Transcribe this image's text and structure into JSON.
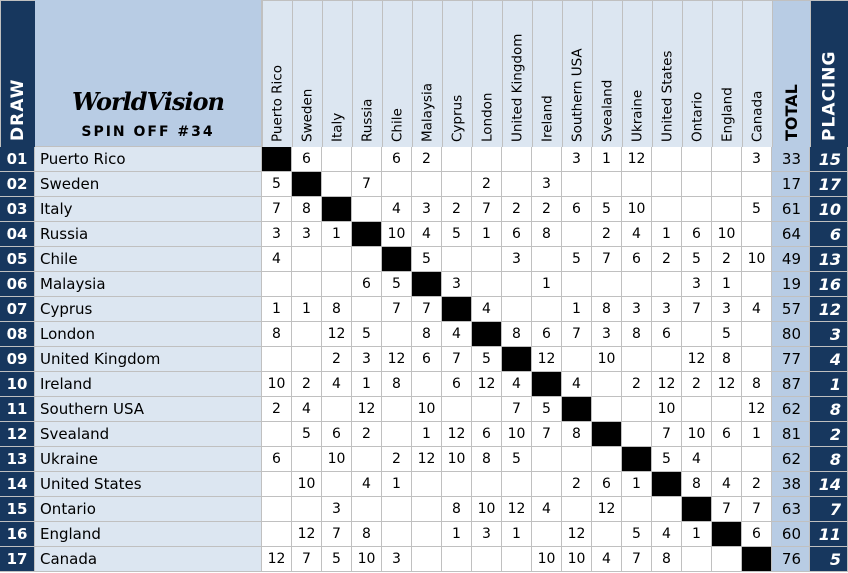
{
  "header": {
    "draw_label": "DRAW",
    "logo": "WorldVision",
    "subtitle": "SPIN OFF #34",
    "total_label": "TOTAL",
    "placing_label": "PLACING"
  },
  "juries": [
    "Puerto Rico",
    "Sweden",
    "Italy",
    "Russia",
    "Chile",
    "Malaysia",
    "Cyprus",
    "London",
    "United Kingdom",
    "Ireland",
    "Southern USA",
    "Svealand",
    "Ukraine",
    "United States",
    "Ontario",
    "England",
    "Canada"
  ],
  "colors": {
    "navy": "#17375e",
    "header_blue": "#b8cce4",
    "row_blue": "#dce6f1",
    "diagonal": "#000000"
  },
  "rows": [
    {
      "draw": "01",
      "name": "Puerto Rico",
      "points": [
        "",
        "6",
        "",
        "",
        "6",
        "2",
        "",
        "",
        "",
        "",
        "3",
        "1",
        "12",
        "",
        "",
        "",
        "3"
      ],
      "total": "33",
      "placing": "15"
    },
    {
      "draw": "02",
      "name": "Sweden",
      "points": [
        "5",
        "",
        "",
        "7",
        "",
        "",
        "",
        "2",
        "",
        "3",
        "",
        "",
        "",
        "",
        "",
        "",
        ""
      ],
      "total": "17",
      "placing": "17"
    },
    {
      "draw": "03",
      "name": "Italy",
      "points": [
        "7",
        "8",
        "",
        "",
        "4",
        "3",
        "2",
        "7",
        "2",
        "2",
        "6",
        "5",
        "10",
        "",
        "",
        "",
        "5"
      ],
      "total": "61",
      "placing": "10"
    },
    {
      "draw": "04",
      "name": "Russia",
      "points": [
        "3",
        "3",
        "1",
        "",
        "10",
        "4",
        "5",
        "1",
        "6",
        "8",
        "",
        "2",
        "4",
        "1",
        "6",
        "10",
        ""
      ],
      "total": "64",
      "placing": "6"
    },
    {
      "draw": "05",
      "name": "Chile",
      "points": [
        "4",
        "",
        "",
        "",
        "",
        "5",
        "",
        "",
        "3",
        "",
        "5",
        "7",
        "6",
        "2",
        "5",
        "2",
        "10"
      ],
      "total": "49",
      "placing": "13"
    },
    {
      "draw": "06",
      "name": "Malaysia",
      "points": [
        "",
        "",
        "",
        "6",
        "5",
        "",
        "3",
        "",
        "",
        "1",
        "",
        "",
        "",
        "",
        "3",
        "1",
        ""
      ],
      "total": "19",
      "placing": "16"
    },
    {
      "draw": "07",
      "name": "Cyprus",
      "points": [
        "1",
        "1",
        "8",
        "",
        "7",
        "7",
        "",
        "4",
        "",
        "",
        "1",
        "8",
        "3",
        "3",
        "7",
        "3",
        "4"
      ],
      "total": "57",
      "placing": "12"
    },
    {
      "draw": "08",
      "name": "London",
      "points": [
        "8",
        "",
        "12",
        "5",
        "",
        "8",
        "4",
        "",
        "8",
        "6",
        "7",
        "3",
        "8",
        "6",
        "",
        "5",
        ""
      ],
      "total": "80",
      "placing": "3"
    },
    {
      "draw": "09",
      "name": "United Kingdom",
      "points": [
        "",
        "",
        "2",
        "3",
        "12",
        "6",
        "7",
        "5",
        "",
        "12",
        "",
        "10",
        "",
        "",
        "12",
        "8",
        ""
      ],
      "total": "77",
      "placing": "4"
    },
    {
      "draw": "10",
      "name": "Ireland",
      "points": [
        "10",
        "2",
        "4",
        "1",
        "8",
        "",
        "6",
        "12",
        "4",
        "",
        "4",
        "",
        "2",
        "12",
        "2",
        "12",
        "8"
      ],
      "total": "87",
      "placing": "1"
    },
    {
      "draw": "11",
      "name": "Southern USA",
      "points": [
        "2",
        "4",
        "",
        "12",
        "",
        "10",
        "",
        "",
        "7",
        "5",
        "",
        "",
        "",
        "10",
        "",
        "",
        "12"
      ],
      "total": "62",
      "placing": "8"
    },
    {
      "draw": "12",
      "name": "Svealand",
      "points": [
        "",
        "5",
        "6",
        "2",
        "",
        "1",
        "12",
        "6",
        "10",
        "7",
        "8",
        "",
        "",
        "7",
        "10",
        "6",
        "1"
      ],
      "total": "81",
      "placing": "2"
    },
    {
      "draw": "13",
      "name": "Ukraine",
      "points": [
        "6",
        "",
        "10",
        "",
        "2",
        "12",
        "10",
        "8",
        "5",
        "",
        "",
        "",
        "",
        "5",
        "4",
        "",
        ""
      ],
      "total": "62",
      "placing": "8"
    },
    {
      "draw": "14",
      "name": "United States",
      "points": [
        "",
        "10",
        "",
        "4",
        "1",
        "",
        "",
        "",
        "",
        "",
        "2",
        "6",
        "1",
        "",
        "8",
        "4",
        "2"
      ],
      "total": "38",
      "placing": "14"
    },
    {
      "draw": "15",
      "name": "Ontario",
      "points": [
        "",
        "",
        "3",
        "",
        "",
        "",
        "8",
        "10",
        "12",
        "4",
        "",
        "12",
        "",
        "",
        "",
        "7",
        "7"
      ],
      "total": "63",
      "placing": "7"
    },
    {
      "draw": "16",
      "name": "England",
      "points": [
        "",
        "12",
        "7",
        "8",
        "",
        "",
        "1",
        "3",
        "1",
        "",
        "12",
        "",
        "5",
        "4",
        "1",
        "",
        "6"
      ],
      "total": "60",
      "placing": "11"
    },
    {
      "draw": "17",
      "name": "Canada",
      "points": [
        "12",
        "7",
        "5",
        "10",
        "3",
        "",
        "",
        "",
        "",
        "10",
        "10",
        "4",
        "7",
        "8",
        "",
        "",
        ""
      ],
      "total": "76",
      "placing": "5"
    }
  ]
}
